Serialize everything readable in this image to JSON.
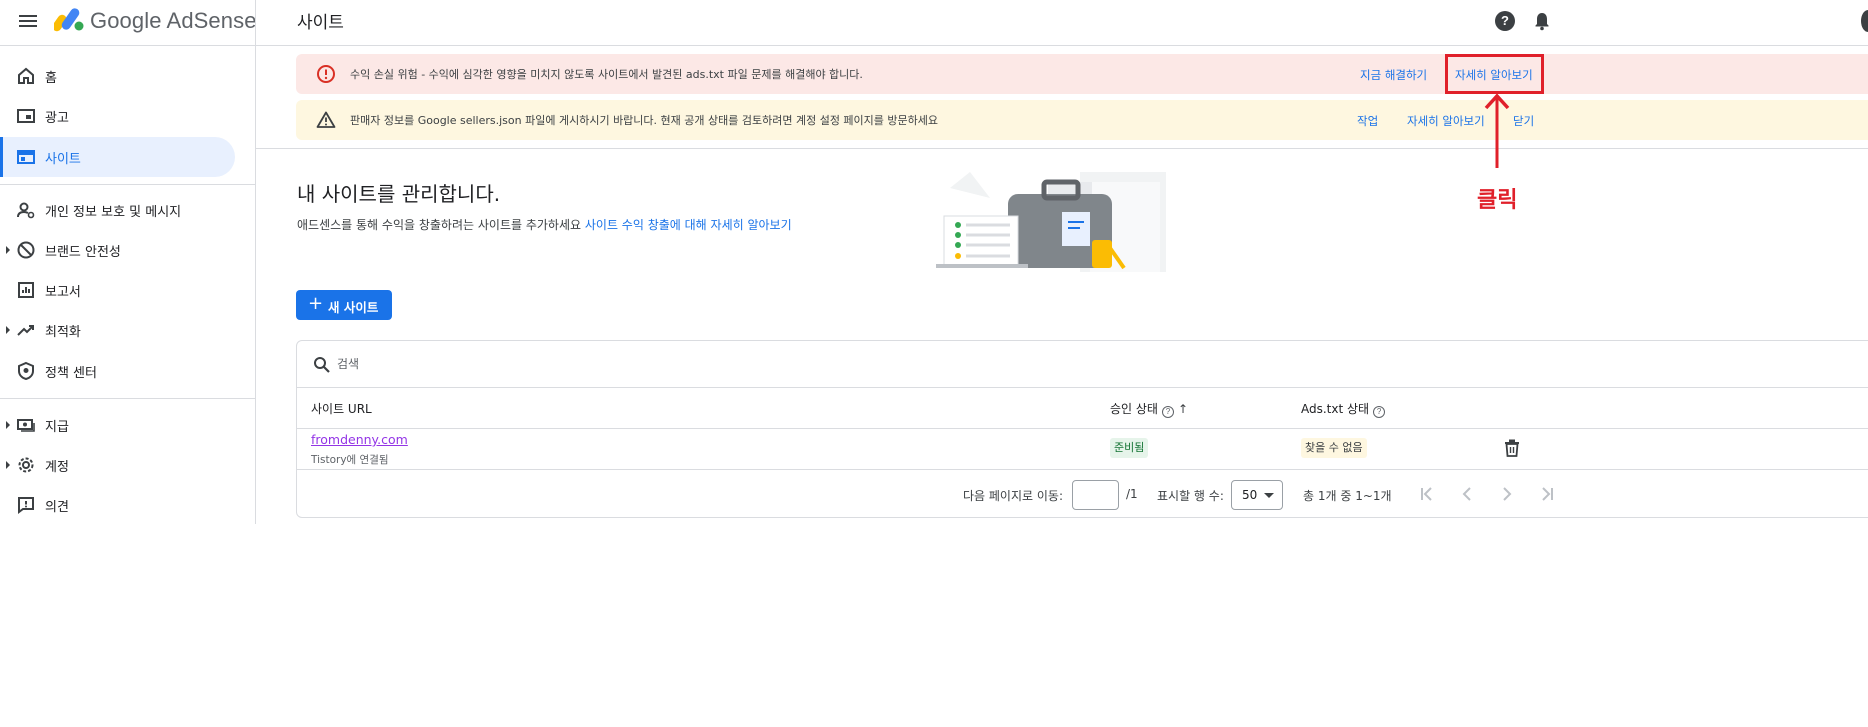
{
  "app": {
    "brand": "Google AdSense",
    "page_title": "사이트",
    "help_glyph": "?"
  },
  "sidebar": {
    "items": [
      {
        "label": "홈",
        "icon": "home-icon"
      },
      {
        "label": "광고",
        "icon": "ads-icon"
      },
      {
        "label": "사이트",
        "icon": "sites-icon",
        "active": true
      },
      {
        "label": "개인 정보 보호 및 메시지",
        "icon": "privacy-icon"
      },
      {
        "label": "브랜드 안전성",
        "icon": "block-icon"
      },
      {
        "label": "보고서",
        "icon": "reports-icon"
      },
      {
        "label": "최적화",
        "icon": "trending-icon"
      },
      {
        "label": "정책 센터",
        "icon": "shield-icon"
      },
      {
        "label": "지급",
        "icon": "payments-icon"
      },
      {
        "label": "계정",
        "icon": "gear-icon"
      },
      {
        "label": "의견",
        "icon": "feedback-icon"
      }
    ]
  },
  "banners": {
    "error": {
      "text": "수익 손실 위험 - 수익에 심각한 영향을 미치지 않도록 사이트에서 발견된 ads.txt 파일 문제를 해결해야 합니다.",
      "fix_link": "지금 해결하기",
      "learn_link": "자세히 알아보기"
    },
    "warning": {
      "text": "판매자 정보를 Google sellers.json 파일에 게시하시기 바랍니다. 현재 공개 상태를 검토하려면 계정 설정 페이지를 방문하세요",
      "action_link": "작업",
      "learn_link": "자세히 알아보기",
      "close_link": "닫기"
    }
  },
  "annotation": {
    "label": "클릭",
    "color": "#e0202a"
  },
  "hero": {
    "title": "내 사이트를 관리합니다.",
    "description": "애드센스를 통해 수익을 창출하려는 사이트를 추가하세요",
    "link": "사이트 수익 창출에 대해 자세히 알아보기"
  },
  "new_site_button": {
    "plus": "+",
    "label": "새 사이트"
  },
  "table": {
    "search_placeholder": "검색",
    "headers": {
      "url": "사이트 URL",
      "approval": "승인 상태",
      "ads_txt": "Ads.txt 상태",
      "help_glyph": "?",
      "sort_glyph": "↑"
    },
    "rows": [
      {
        "url": "fromdenny.com",
        "sub": "Tistory에 연결됨",
        "approval": "준비됨",
        "ads_txt": "찾을 수 없음"
      }
    ]
  },
  "pagination": {
    "goto_label": "다음 페이지로 이동:",
    "page_input": "",
    "page_total": "/1",
    "rows_label": "표시할 행 수:",
    "rows_value": "50",
    "range": "총 1개 중 1~1개"
  },
  "colors": {
    "accent": "#1a73e8",
    "error_bg": "#fce8e6",
    "warning_bg": "#fef7e0",
    "visited_link": "#9334e6"
  }
}
